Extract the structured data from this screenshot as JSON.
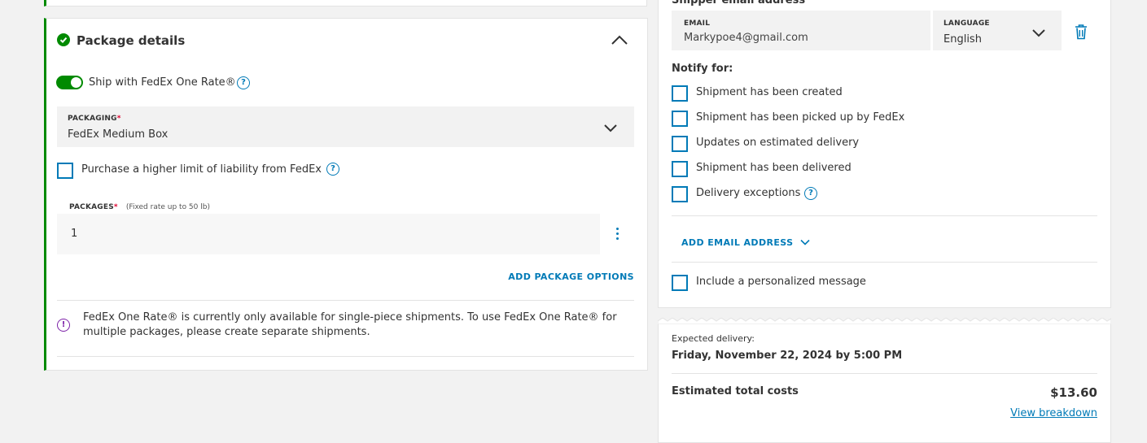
{
  "package_details": {
    "title": "Package details",
    "one_rate_toggle": {
      "label": "Ship with FedEx One Rate®",
      "on": true
    },
    "packaging": {
      "label": "PACKAGING",
      "required": "*",
      "value": "FedEx Medium Box"
    },
    "liability": {
      "label": "Purchase a higher limit of liability from FedEx",
      "checked": false
    },
    "packages": {
      "label": "PACKAGES",
      "required": "*",
      "hint": "(Fixed rate up to 50 lb)",
      "value": "1"
    },
    "add_options_label": "ADD PACKAGE OPTIONS",
    "notice": "FedEx One Rate® is currently only available for single-piece shipments. To use FedEx One Rate® for multiple packages, please create separate shipments."
  },
  "notifications": {
    "section_label": "Shipper email address",
    "email": {
      "label": "EMAIL",
      "value": "Markypoe4@gmail.com"
    },
    "language": {
      "label": "LANGUAGE",
      "value": "English"
    },
    "notify_title": "Notify for:",
    "options": [
      {
        "label": "Shipment has been created",
        "checked": false
      },
      {
        "label": "Shipment has been picked up by FedEx",
        "checked": false
      },
      {
        "label": "Updates on estimated delivery",
        "checked": false
      },
      {
        "label": "Shipment has been delivered",
        "checked": false
      },
      {
        "label": "Delivery exceptions",
        "checked": false
      }
    ],
    "add_email_label": "ADD EMAIL ADDRESS",
    "personalized_message_label": "Include a personalized message"
  },
  "summary": {
    "expected_label": "Expected delivery:",
    "expected_date": "Friday, November 22, 2024 by 5:00 PM",
    "total_label": "Estimated total costs",
    "total_value": "$13.60",
    "breakdown_link": "View breakdown"
  },
  "colors": {
    "accent": "#007ab7",
    "success": "#008a00",
    "required": "#de002e",
    "info": "#7d22a8"
  },
  "icons": [
    "check-circle-icon",
    "chevron-up-icon",
    "help-icon",
    "chevron-down-icon",
    "kebab-icon",
    "info-icon",
    "trash-icon"
  ]
}
